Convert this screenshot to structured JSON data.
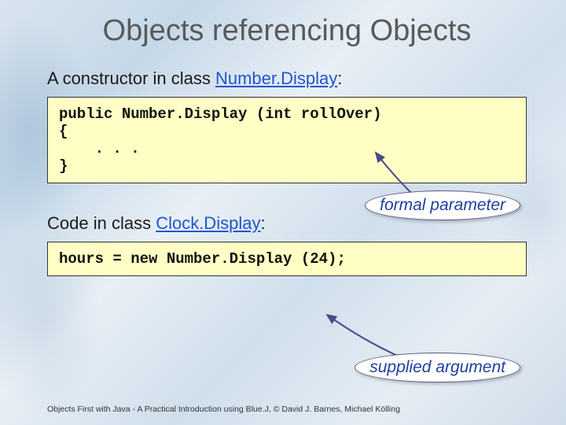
{
  "title": "Objects referencing Objects",
  "section1": {
    "intro_prefix": "A constructor in class ",
    "class_name": "Number.Display",
    "intro_suffix": ":",
    "code": "public Number.Display (int rollOver)\n{\n    . . .\n}",
    "callout": "formal parameter"
  },
  "section2": {
    "intro_prefix": "Code in class ",
    "class_name": "Clock.Display",
    "intro_suffix": ":",
    "code": "hours = new Number.Display (24);",
    "callout": "supplied argument"
  },
  "footer": "Objects First with Java - A Practical Introduction using Blue.J, © David J. Barnes, Michael Kölling"
}
